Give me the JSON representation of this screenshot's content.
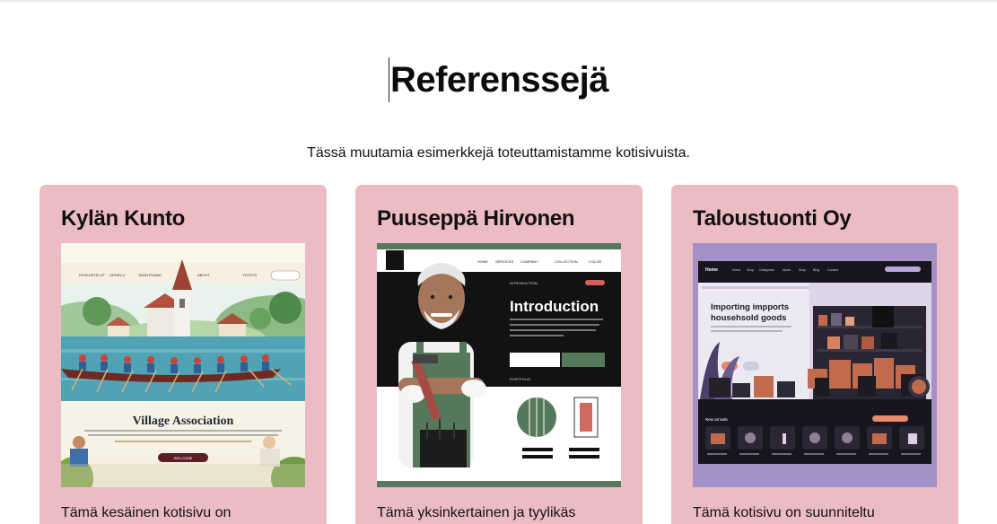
{
  "header": {
    "title": "Referenssejä",
    "subtitle": "Tässä muutamia esimerkkejä toteuttamistamme kotisivuista."
  },
  "cards": [
    {
      "title": "Kylän Kunto",
      "description": "Tämä kesäinen kotisivu on",
      "mock": {
        "nav": [
          "KESKUSTELUT",
          "URHEILU",
          "TAPAHTUMAT",
          "ABOUT",
          "YHTEYS"
        ],
        "heading": "Village Association",
        "button": "WELCOME"
      }
    },
    {
      "title": "Puuseppä Hirvonen",
      "description": "Tämä yksinkertainen ja tyylikäs",
      "mock": {
        "nav": [
          "HOME",
          "SERVICES",
          "COMPANY",
          "COLLECTION",
          "COLOR"
        ],
        "heading": "Introduction",
        "tag": "INTRODUCTION",
        "section": "PORTFOLIO"
      }
    },
    {
      "title": "Taloustuonti Oy",
      "description": "Tämä kotisivu on suunniteltu",
      "mock": {
        "brand": "Home",
        "nav": [
          "Home",
          "Shop",
          "Categories",
          "About",
          "Shop",
          "Blog",
          "Contact"
        ],
        "heading_line1": "Importing impports",
        "heading_line2": "househsold goods",
        "section": "New arrivals"
      }
    }
  ],
  "colors": {
    "card_bg": "#ecbcc4",
    "green": "#55795a",
    "dark": "#121212",
    "purple": "#a491c6"
  }
}
